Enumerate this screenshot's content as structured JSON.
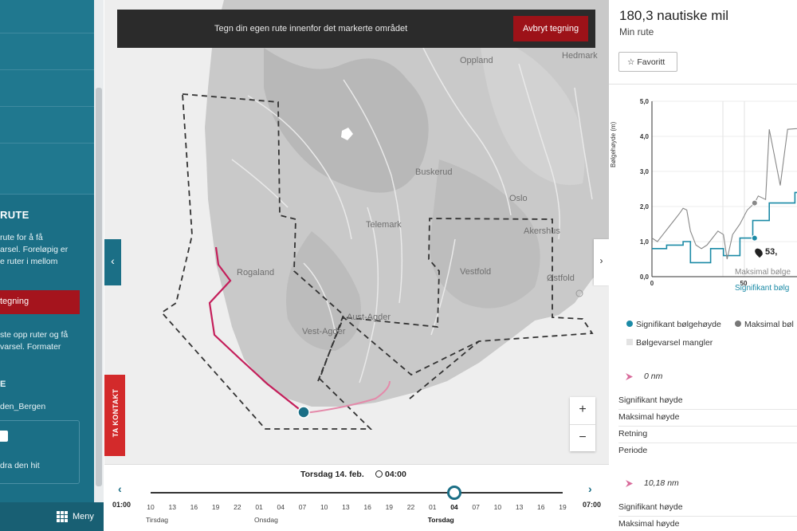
{
  "sidebar": {
    "heading": "RUTE",
    "text1": [
      "rute for å få",
      "arsel. Foreløpig er",
      "e ruter i mellom"
    ],
    "red_button": "tegning",
    "text2": [
      "ste opp ruter og få",
      "varsel. Formater"
    ],
    "label_e": "E",
    "route_name": "den_Bergen",
    "box_text": "dra den hit",
    "menu_label": "Meny"
  },
  "banner": {
    "message": "Tegn din egen rute innenfor det markerte området",
    "cancel_label": "Avbryt tegning"
  },
  "map": {
    "contact_label": "TA KONTAKT",
    "zoom_in": "+",
    "zoom_out": "−",
    "places": {
      "oppland": "Oppland",
      "hedmark": "Hedmark",
      "buskerud": "Buskerud",
      "oslo": "Oslo",
      "akershus": "Akershus",
      "telemark": "Telemark",
      "rogaland": "Rogaland",
      "vestfold": "Vestfold",
      "ostfold": "Østfold",
      "vest_agder": "Vest-Agder",
      "aust_agder": "Aust-Agder"
    }
  },
  "timeline": {
    "date": "Torsdag 14. feb.",
    "time": "04:00",
    "start": "01:00",
    "end": "07:00",
    "ticks": [
      "10",
      "13",
      "16",
      "19",
      "22",
      "01",
      "04",
      "07",
      "10",
      "13",
      "16",
      "19",
      "22",
      "01",
      "04",
      "07",
      "10",
      "13",
      "16",
      "19"
    ],
    "selected_tick_index": 14,
    "days": [
      {
        "label": "Tirsdag",
        "tick_index": 0
      },
      {
        "label": "Onsdag",
        "tick_index": 5
      },
      {
        "label": "Torsdag",
        "tick_index": 13
      }
    ]
  },
  "panel": {
    "title": "180,3 nautiske mil",
    "subtitle": "Min rute",
    "favorite_label": "Favoritt",
    "distance_badge": "53,",
    "bg_max_label": "Maksimal bølge",
    "bg_sig_label": "Signifikant bølg",
    "legend": {
      "sig": "Signifikant bølgehøyde",
      "max": "Maksimal bøl",
      "missing": "Bølgevarsel mangler"
    },
    "segments": [
      {
        "distance": "0 nm",
        "rows": [
          "Signifikant høyde",
          "Maksimal høyde",
          "Retning",
          "Periode"
        ]
      },
      {
        "distance": "10,18 nm",
        "rows": [
          "Signifikant høyde",
          "Maksimal høyde"
        ]
      }
    ]
  },
  "chart_data": {
    "type": "line",
    "ylabel": "Bølgehøyde (m)",
    "xlabel": "",
    "ylim": [
      0,
      5
    ],
    "xlim": [
      0,
      100
    ],
    "yticks": [
      "0,0",
      "1,0",
      "2,0",
      "3,0",
      "4,0",
      "5,0"
    ],
    "xticks": [
      "0",
      "50"
    ],
    "series": [
      {
        "name": "Signifikant bølgehøyde",
        "color": "#1b8aa6",
        "x": [
          0,
          8,
          8,
          17,
          17,
          21,
          21,
          32,
          32,
          39,
          39,
          48,
          48,
          55,
          55,
          64,
          64,
          78,
          78,
          100
        ],
        "y": [
          0.8,
          0.8,
          0.9,
          0.9,
          1.0,
          1.0,
          0.4,
          0.4,
          0.8,
          0.8,
          0.6,
          0.6,
          1.1,
          1.1,
          1.6,
          1.6,
          2.1,
          2.1,
          2.4,
          2.4
        ]
      },
      {
        "name": "Maksimal bølgehøyde",
        "color": "#888888",
        "x": [
          0,
          3,
          6,
          9,
          12,
          15,
          17,
          19,
          21,
          24,
          27,
          30,
          33,
          36,
          39,
          41,
          44,
          48,
          52,
          56,
          58,
          62,
          64,
          70,
          74,
          100
        ],
        "y": [
          1.1,
          1.0,
          1.2,
          1.4,
          1.6,
          1.8,
          1.95,
          1.9,
          1.3,
          0.9,
          0.8,
          0.9,
          1.1,
          1.3,
          1.2,
          0.5,
          1.2,
          1.5,
          1.9,
          2.1,
          2.3,
          2.2,
          4.2,
          2.6,
          4.2,
          4.3
        ]
      }
    ],
    "markers": [
      {
        "series": "Signifikant bølgehøyde",
        "x": 56,
        "y": 1.1
      },
      {
        "series": "Maksimal bølgehøyde",
        "x": 56,
        "y": 2.1
      }
    ]
  }
}
